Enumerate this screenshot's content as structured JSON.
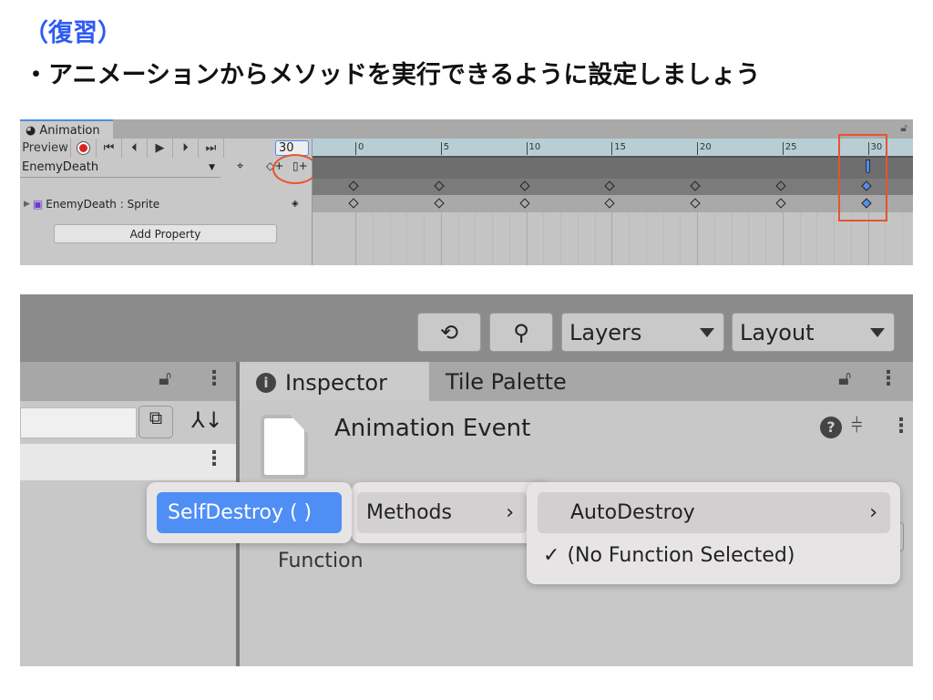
{
  "slide": {
    "title": "（復習）",
    "bullet": "・アニメーションからメソッドを実行できるように設定しましょう"
  },
  "animation_window": {
    "tab": "Animation",
    "preview": "Preview",
    "frame": "30",
    "clip": "EnemyDeath",
    "property": "EnemyDeath : Sprite",
    "add_property": "Add Property",
    "ruler_ticks": [
      "0",
      "5",
      "10",
      "15",
      "20",
      "25",
      "30"
    ],
    "keyframes": [
      0,
      5,
      10,
      15,
      20,
      25,
      30
    ],
    "selected_frame": 30,
    "event_frame": 30,
    "highlight_color": "#e8532f",
    "selection_color": "#5a8de8"
  },
  "editor": {
    "toolbar": {
      "layers": "Layers",
      "layout": "Layout"
    },
    "tabs": {
      "inspector": "Inspector",
      "tile_palette": "Tile Palette"
    },
    "inspector_title": "Animation Event",
    "hidden_label": "Function",
    "menu": {
      "selected": "SelfDestroy ( )",
      "methods": "Methods",
      "autodestroy": "AutoDestroy",
      "none": "(No Function Selected)"
    },
    "accent": "#4f8ef5"
  }
}
